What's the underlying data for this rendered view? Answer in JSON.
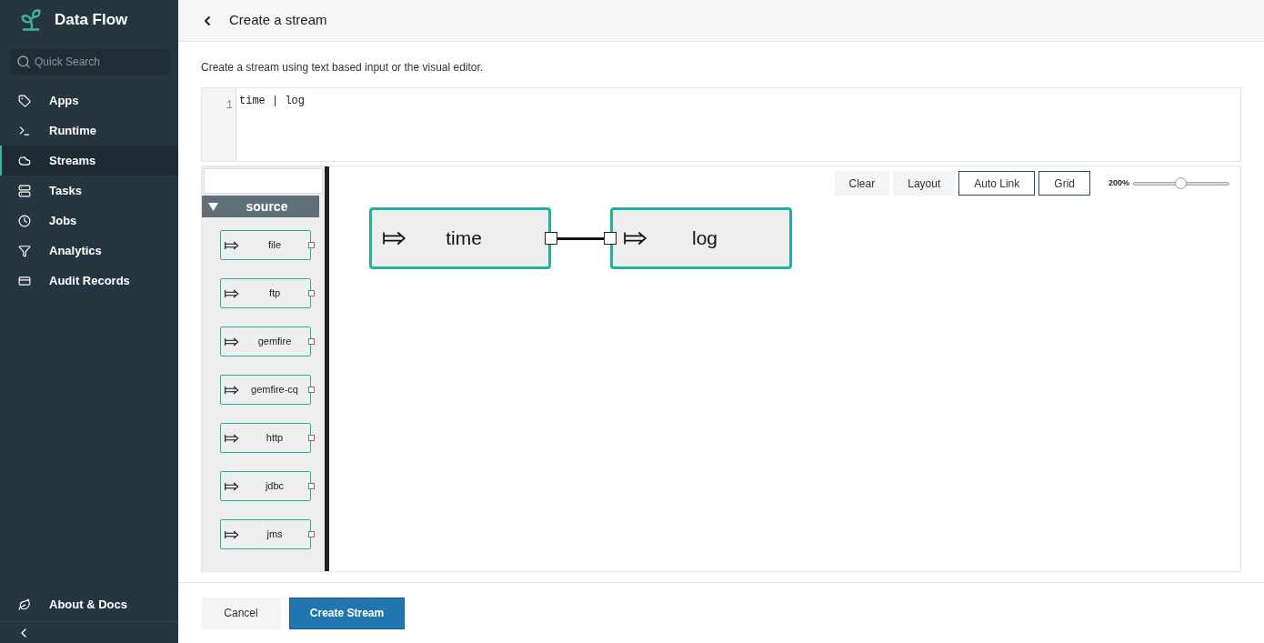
{
  "app": {
    "title": "Data Flow"
  },
  "search": {
    "placeholder": "Quick Search"
  },
  "nav": [
    {
      "label": "Apps",
      "selected": false
    },
    {
      "label": "Runtime",
      "selected": false
    },
    {
      "label": "Streams",
      "selected": true
    },
    {
      "label": "Tasks",
      "selected": false
    },
    {
      "label": "Jobs",
      "selected": false
    },
    {
      "label": "Analytics",
      "selected": false
    },
    {
      "label": "Audit Records",
      "selected": false
    }
  ],
  "footer_nav": {
    "label": "About & Docs"
  },
  "page": {
    "title": "Create a stream",
    "intro": "Create a stream using text based input or the visual editor."
  },
  "editor": {
    "line_number": "1",
    "code": "time | log"
  },
  "palette": {
    "group": "source",
    "expanded": true,
    "items": [
      "file",
      "ftp",
      "gemfire",
      "gemfire-cq",
      "http",
      "jdbc",
      "jms"
    ]
  },
  "toolbar": {
    "buttons": [
      {
        "label": "Clear",
        "kind": "plain"
      },
      {
        "label": "Layout",
        "kind": "plain"
      },
      {
        "label": "Auto Link",
        "kind": "outline"
      },
      {
        "label": "Grid",
        "kind": "outline"
      }
    ],
    "zoom": {
      "reading": "200%",
      "level": 0.49
    }
  },
  "canvas": {
    "nodes": [
      {
        "label": "time",
        "kind": "source"
      },
      {
        "label": "log",
        "kind": "sink"
      }
    ]
  },
  "actions": {
    "cancel": "Cancel",
    "submit": "Create Stream"
  }
}
